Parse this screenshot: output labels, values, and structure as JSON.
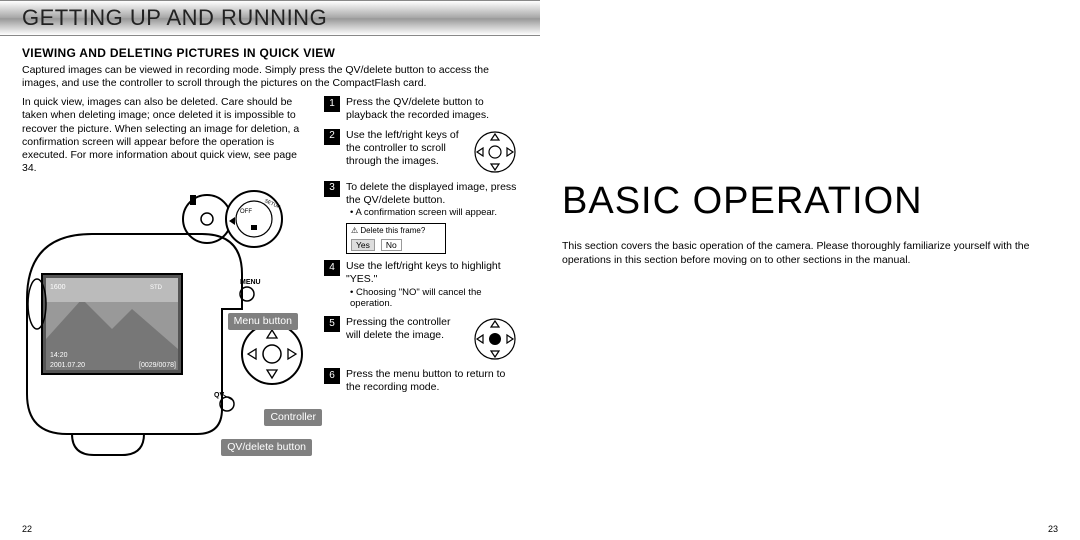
{
  "left": {
    "header": "GETTING UP AND RUNNING",
    "subheading": "VIEWING AND DELETING PICTURES IN QUICK VIEW",
    "intro": "Captured images can be viewed in recording mode. Simply press the QV/delete button to access the images, and use the controller to scroll through the pictures on the CompactFlash card.",
    "colA_text": "In quick view, images can also be deleted. Care should be taken when deleting image; once deleted it is impossible to recover the picture. When selecting an image for deletion, a confirmation screen will appear before the operation is executed. For more information about quick view, see page 34.",
    "steps": [
      {
        "n": "1",
        "text": "Press the QV/delete button to playback the recorded images.",
        "sub": "",
        "glyph": false
      },
      {
        "n": "2",
        "text": "Use the left/right keys of the controller to scroll through the images.",
        "sub": "",
        "glyph": true
      },
      {
        "n": "3",
        "text": "To delete the displayed image, press the QV/delete button.",
        "sub": "• A confirmation screen will appear.",
        "glyph": false,
        "dialog": true
      },
      {
        "n": "4",
        "text": "Use the left/right keys to highlight \"YES.\"",
        "sub": "• Choosing \"NO\" will cancel the operation.",
        "glyph": false
      },
      {
        "n": "5",
        "text": "Pressing the controller will delete the image.",
        "sub": "",
        "glyph": true
      },
      {
        "n": "6",
        "text": "Press the menu button to return to the recording mode.",
        "sub": "",
        "glyph": false
      }
    ],
    "dialog": {
      "title": "⚠ Delete this frame?",
      "yes": "Yes",
      "no": "No"
    },
    "callouts": {
      "menu": "Menu button",
      "controller": "Controller",
      "qv": "QV/delete button"
    },
    "camera": {
      "menu_label": "MENU",
      "qv_label": "QV",
      "setup_label": "SETUP",
      "off_label": "OFF",
      "lcd_time": "14:20",
      "lcd_date": "2001.07.20",
      "lcd_count": "[0029/0078]",
      "lcd_iso": "1600",
      "lcd_mode": "STD"
    },
    "pageno": "22"
  },
  "right": {
    "title": "BASIC OPERATION",
    "body": "This section covers the basic operation of the camera. Please thoroughly familiarize yourself with the operations in this section before moving on to other sections in the manual.",
    "pageno": "23"
  }
}
